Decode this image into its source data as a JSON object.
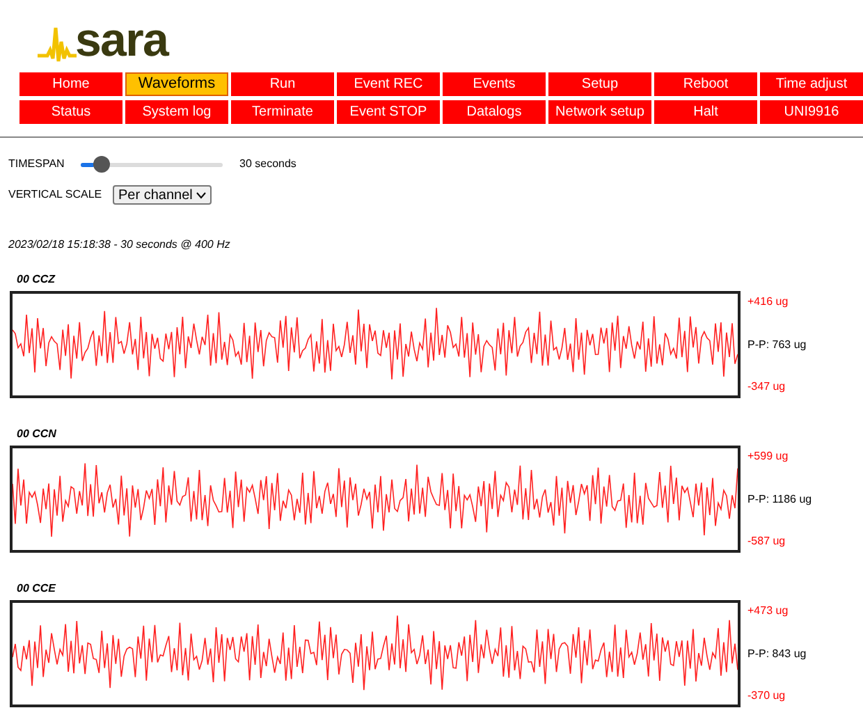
{
  "logo": {
    "text": "sara"
  },
  "nav": [
    {
      "label": "Home",
      "selected": false
    },
    {
      "label": "Waveforms",
      "selected": true
    },
    {
      "label": "Run",
      "selected": false
    },
    {
      "label": "Event REC",
      "selected": false
    },
    {
      "label": "Events",
      "selected": false
    },
    {
      "label": "Setup",
      "selected": false
    },
    {
      "label": "Reboot",
      "selected": false
    },
    {
      "label": "Time adjust",
      "selected": false
    },
    {
      "label": "Status",
      "selected": false
    },
    {
      "label": "System log",
      "selected": false
    },
    {
      "label": "Terminate",
      "selected": false
    },
    {
      "label": "Event STOP",
      "selected": false
    },
    {
      "label": "Datalogs",
      "selected": false
    },
    {
      "label": "Network setup",
      "selected": false
    },
    {
      "label": "Halt",
      "selected": false
    },
    {
      "label": "UNI9916",
      "selected": false
    }
  ],
  "timespan": {
    "label": "TIMESPAN",
    "level": 0.1,
    "reading": "30 seconds"
  },
  "vertical_scale": {
    "label": "VERTICAL SCALE",
    "value": "Per channel"
  },
  "info": "2023/02/18 15:18:38 - 30 seconds @ 400 Hz",
  "channels": [
    {
      "name": "00 CCZ",
      "max": "+416 ug",
      "pp": "P-P: 763 ug",
      "min": "-347 ug"
    },
    {
      "name": "00 CCN",
      "max": "+599 ug",
      "pp": "P-P: 1186 ug",
      "min": "-587 ug"
    },
    {
      "name": "00 CCE",
      "max": "+473 ug",
      "pp": "P-P: 843 ug",
      "min": "-370 ug"
    }
  ]
}
